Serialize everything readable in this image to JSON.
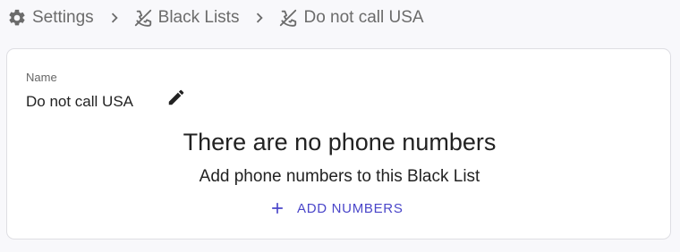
{
  "breadcrumb": {
    "items": [
      {
        "label": "Settings",
        "icon": "gear-icon"
      },
      {
        "label": "Black Lists",
        "icon": "phone-blocked-icon"
      },
      {
        "label": "Do not call USA",
        "icon": "phone-blocked-icon"
      }
    ],
    "separator_icon": "chevron-right-icon"
  },
  "name_field": {
    "label": "Name",
    "value": "Do not call USA",
    "edit_icon": "pencil-icon"
  },
  "empty_state": {
    "title": "There are no phone numbers",
    "subtitle": "Add phone numbers to this Black List",
    "add_button_label": "ADD NUMBERS",
    "add_icon": "plus-icon"
  },
  "colors": {
    "accent": "#4a46c9",
    "breadcrumb_text": "#6b6b6b",
    "page_background": "#f8f8fb",
    "card_background": "#ffffff",
    "card_border": "#dedee3"
  }
}
